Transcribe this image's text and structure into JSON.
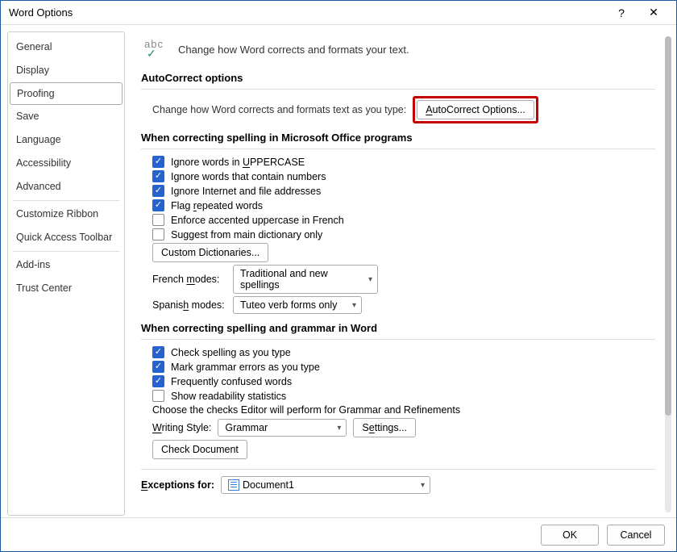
{
  "title": "Word Options",
  "sidebar": {
    "items": [
      {
        "label": "General"
      },
      {
        "label": "Display"
      },
      {
        "label": "Proofing"
      },
      {
        "label": "Save"
      },
      {
        "label": "Language"
      },
      {
        "label": "Accessibility"
      },
      {
        "label": "Advanced"
      }
    ],
    "items2": [
      {
        "label": "Customize Ribbon"
      },
      {
        "label": "Quick Access Toolbar"
      }
    ],
    "items3": [
      {
        "label": "Add-ins"
      },
      {
        "label": "Trust Center"
      }
    ],
    "selected": "Proofing"
  },
  "banner": "Change how Word corrects and formats your text.",
  "sections": {
    "autocorrect": {
      "title": "AutoCorrect options",
      "label": "Change how Word corrects and formats text as you type:",
      "button": "AutoCorrect Options..."
    },
    "office_spell": {
      "title": "When correcting spelling in Microsoft Office programs",
      "checks": [
        {
          "label": "Ignore words in UPPERCASE",
          "checked": true
        },
        {
          "label": "Ignore words that contain numbers",
          "checked": true
        },
        {
          "label": "Ignore Internet and file addresses",
          "checked": true
        },
        {
          "label": "Flag repeated words",
          "checked": true
        },
        {
          "label": "Enforce accented uppercase in French",
          "checked": false
        },
        {
          "label": "Suggest from main dictionary only",
          "checked": false
        }
      ],
      "custom_dict_btn": "Custom Dictionaries...",
      "french_label": "French modes:",
      "french_value": "Traditional and new spellings",
      "spanish_label": "Spanish modes:",
      "spanish_value": "Tuteo verb forms only"
    },
    "word_spell": {
      "title": "When correcting spelling and grammar in Word",
      "checks": [
        {
          "label": "Check spelling as you type",
          "checked": true
        },
        {
          "label": "Mark grammar errors as you type",
          "checked": true
        },
        {
          "label": "Frequently confused words",
          "checked": true
        },
        {
          "label": "Show readability statistics",
          "checked": false
        }
      ],
      "editor_label": "Choose the checks Editor will perform for Grammar and Refinements",
      "writing_style_label": "Writing Style:",
      "writing_style_value": "Grammar",
      "settings_btn": "Settings...",
      "check_doc_btn": "Check Document"
    },
    "exceptions": {
      "label": "Exceptions for:",
      "value": "Document1"
    }
  },
  "footer": {
    "ok": "OK",
    "cancel": "Cancel"
  }
}
